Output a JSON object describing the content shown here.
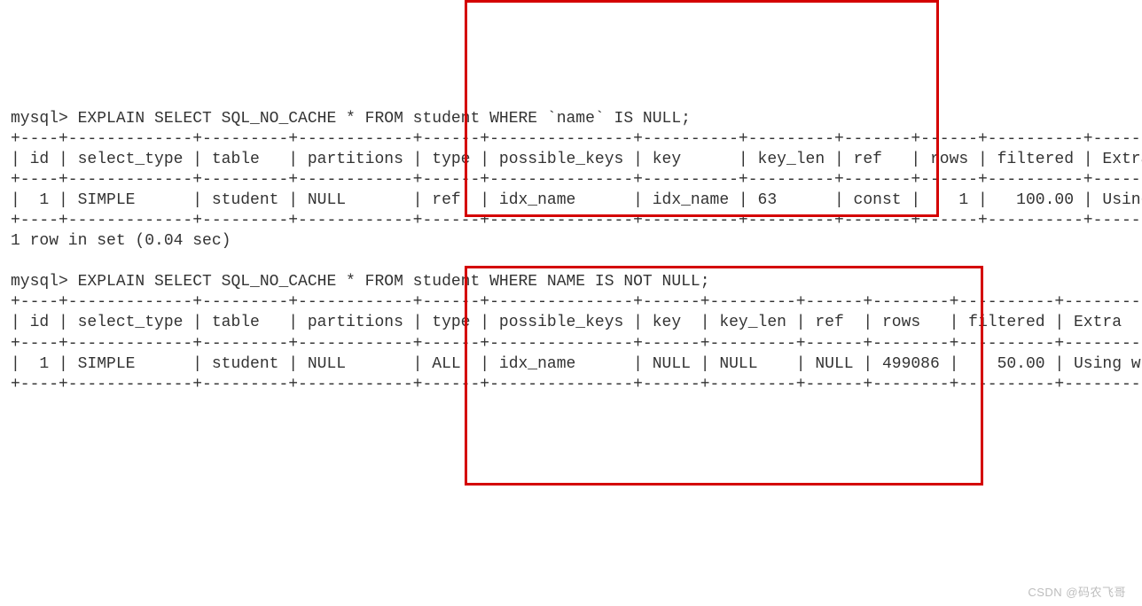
{
  "terminal": {
    "query1": {
      "prompt": "mysql> EXPLAIN SELECT SQL_NO_CACHE * FROM student WHERE `name` IS NULL;",
      "sep_top": "+----+-------------+---------+------------+------+---------------+----------+---------+-------+------+----------+---------------------+",
      "header": "| id | select_type | table   | partitions | type | possible_keys | key      | key_len | ref   | rows | filtered | Extra               |",
      "sep_mid": "+----+-------------+---------+------------+------+---------------+----------+---------+-------+------+----------+---------------------+",
      "row": "|  1 | SIMPLE      | student | NULL       | ref  | idx_name      | idx_name | 63      | const |    1 |   100.00 | Using index condition |",
      "sep_bot": "+----+-------------+---------+------------+------+---------------+----------+---------+-------+------+----------+---------------------+",
      "result": "1 row in set (0.04 sec)"
    },
    "query2": {
      "prompt": "mysql> EXPLAIN SELECT SQL_NO_CACHE * FROM student WHERE NAME IS NOT NULL;",
      "sep_top": "+----+-------------+---------+------------+------+---------------+------+---------+------+--------+----------+-------------+",
      "header": "| id | select_type | table   | partitions | type | possible_keys | key  | key_len | ref  | rows   | filtered | Extra       |",
      "sep_mid": "+----+-------------+---------+------------+------+---------------+------+---------+------+--------+----------+-------------+",
      "row": "|  1 | SIMPLE      | student | NULL       | ALL  | idx_name      | NULL | NULL    | NULL | 499086 |    50.00 | Using where |",
      "sep_bot": "+----+-------------+---------+------------+------+---------------+------+---------+------+--------+----------+-------------+"
    }
  },
  "watermark": "CSDN @码农飞哥"
}
